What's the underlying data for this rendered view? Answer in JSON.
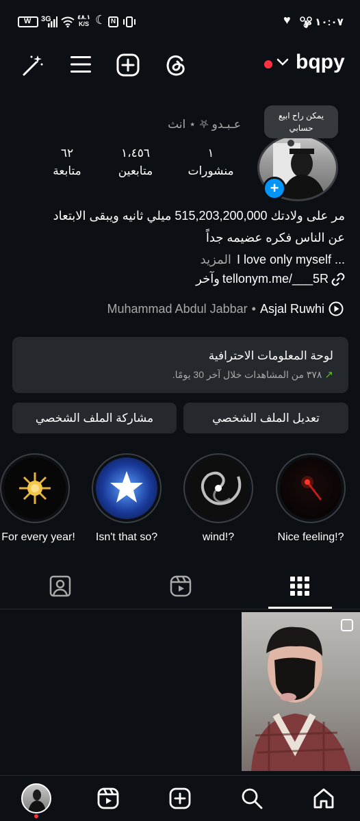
{
  "status_bar": {
    "time": "١٠:٠٧ م",
    "network_speed": "٤٨.١\nK/S",
    "signal_label": "3G",
    "wallet_label": "W"
  },
  "header": {
    "username": "bqpy",
    "live_dot_color": "#ff3040"
  },
  "profile": {
    "tooltip": "يمكن راح ابيع حسابي",
    "display_name": "عـبـدو ⛧ ⋆ انث",
    "stats": [
      {
        "value": "١",
        "label": "منشورات"
      },
      {
        "value": "١،٤٥٦",
        "label": "متابعين"
      },
      {
        "value": "٦٢",
        "label": "متابعة"
      }
    ],
    "bio_line1": "مر على ولادتك 515,203,200,000 ميلي ثانيه ويبقى الابتعاد",
    "bio_line2": "عن الناس فكره عضيمه جداً",
    "bio_line3": "I love only myself ...",
    "more": "المزيد",
    "link_text": "tellonym.me/___5R",
    "link_suffix": "وآخر",
    "music_artist": "Asjal Ruwhi",
    "music_separator": "•",
    "music_title": "Muhammad Abdul Jabbar"
  },
  "dashboard": {
    "title": "لوحة المعلومات الاحترافية",
    "subtitle": "٣٧٨ من المشاهدات خلال آخر 30 يومًا.",
    "trend_color": "#58c322"
  },
  "actions": {
    "edit_profile": "تعديل الملف الشخصي",
    "share_profile": "مشاركة الملف الشخصي"
  },
  "highlights": [
    {
      "label": "Nice feeling!?",
      "icon": "red-light"
    },
    {
      "label": "wind!?",
      "icon": "spiral-galaxy"
    },
    {
      "label": "Isn't that so?",
      "icon": "glowing-star"
    },
    {
      "label": "For every year!",
      "icon": "golden-sun"
    }
  ],
  "tabs": [
    {
      "name": "grid",
      "active": true
    },
    {
      "name": "reels",
      "active": false
    },
    {
      "name": "tagged",
      "active": false
    }
  ],
  "bottom_nav": [
    "home",
    "search",
    "create",
    "reels",
    "profile"
  ],
  "accent": "#0095f6"
}
